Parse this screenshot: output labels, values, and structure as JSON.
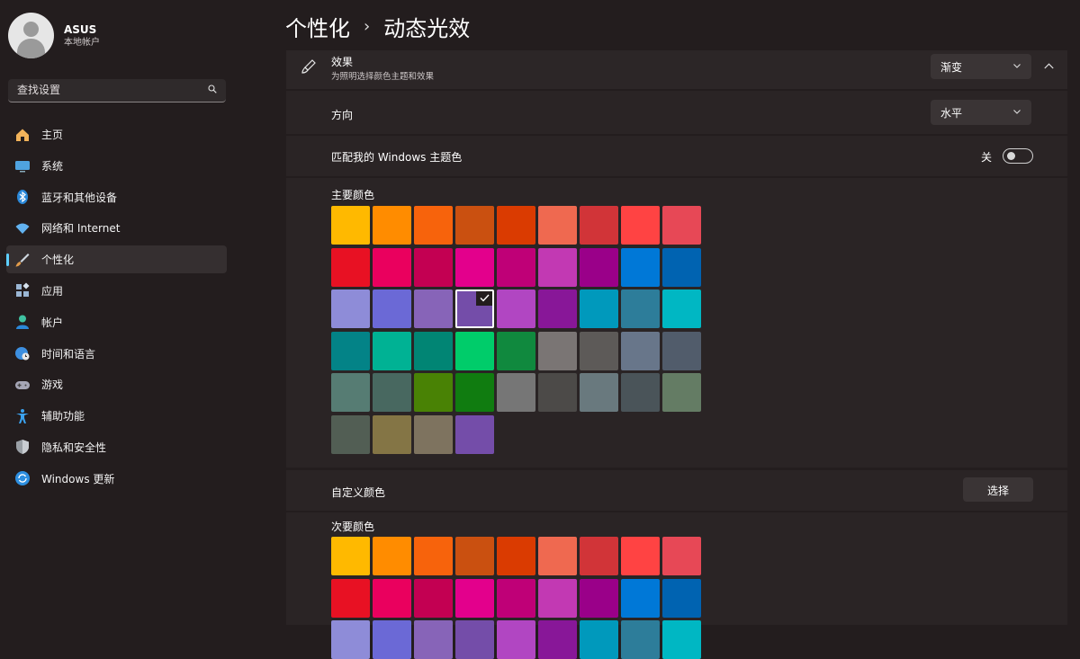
{
  "profile": {
    "name": "ASUS",
    "subtitle": "本地帐户"
  },
  "search": {
    "placeholder": "查找设置",
    "icon": "search-icon"
  },
  "nav": [
    {
      "label": "主页",
      "icon": "home-icon",
      "color": "#f2b35a",
      "active": false
    },
    {
      "label": "系统",
      "icon": "monitor-icon",
      "color": "#4fa3e0",
      "active": false
    },
    {
      "label": "蓝牙和其他设备",
      "icon": "bluetooth-icon",
      "color": "#2b88d8",
      "active": false
    },
    {
      "label": "网络和 Internet",
      "icon": "wifi-icon",
      "color": "#62b2f0",
      "active": false
    },
    {
      "label": "个性化",
      "icon": "brush-icon",
      "color": "#e09a4a",
      "active": true
    },
    {
      "label": "应用",
      "icon": "apps-icon",
      "color": "#9ab6d4",
      "active": false
    },
    {
      "label": "帐户",
      "icon": "account-icon",
      "color": "#3fc2a1",
      "active": false
    },
    {
      "label": "时间和语言",
      "icon": "globe-clock-icon",
      "color": "#3d8fe0",
      "active": false
    },
    {
      "label": "游戏",
      "icon": "gamepad-icon",
      "color": "#a6a6b6",
      "active": false
    },
    {
      "label": "辅助功能",
      "icon": "accessibility-icon",
      "color": "#3ba3f0",
      "active": false
    },
    {
      "label": "隐私和安全性",
      "icon": "shield-icon",
      "color": "#9aa0a6",
      "active": false
    },
    {
      "label": "Windows 更新",
      "icon": "update-icon",
      "color": "#2d8fe0",
      "active": false
    }
  ],
  "breadcrumb": {
    "parent": "个性化",
    "separator": "›",
    "current": "动态光效"
  },
  "effect": {
    "title": "效果",
    "subtitle": "为照明选择颜色主题和效果",
    "value": "渐变"
  },
  "direction": {
    "label": "方向",
    "value": "水平"
  },
  "match_theme": {
    "label": "匹配我的 Windows 主题色",
    "state_label": "关",
    "on": false
  },
  "primary_colors": {
    "label": "主要颜色",
    "selected_index": 21,
    "swatches": [
      "#ffb900",
      "#ff8c00",
      "#f7630c",
      "#ca5010",
      "#da3b01",
      "#ef6950",
      "#d13438",
      "#ff4343",
      "#e74856",
      "#e81123",
      "#ea005e",
      "#c30052",
      "#e3008c",
      "#bf0077",
      "#c239b3",
      "#9a0089",
      "#0078d7",
      "#0063b1",
      "#8e8cd8",
      "#6b69d6",
      "#8764b8",
      "#744da9",
      "#b146c2",
      "#881798",
      "#0099bc",
      "#2d7d9a",
      "#00b7c3",
      "#038387",
      "#00b294",
      "#018574",
      "#00cc6a",
      "#10893e",
      "#7a7574",
      "#5d5a58",
      "#68768a",
      "#515c6b",
      "#567c73",
      "#486860",
      "#498205",
      "#107c10",
      "#767676",
      "#4c4a48",
      "#69797e",
      "#4a5459",
      "#647c64",
      "#525e54",
      "#847545",
      "#7e735f",
      "#744da9"
    ]
  },
  "custom_color": {
    "label": "自定义颜色",
    "button": "选择"
  },
  "secondary_colors": {
    "label": "次要颜色",
    "swatches": [
      "#ffb900",
      "#ff8c00",
      "#f7630c",
      "#ca5010",
      "#da3b01",
      "#ef6950",
      "#d13438",
      "#ff4343",
      "#e74856",
      "#e81123",
      "#ea005e",
      "#c30052",
      "#e3008c",
      "#bf0077",
      "#c239b3",
      "#9a0089",
      "#0078d7",
      "#0063b1",
      "#8e8cd8",
      "#6b69d6",
      "#8764b8",
      "#744da9",
      "#b146c2",
      "#881798",
      "#0099bc",
      "#2d7d9a",
      "#00b7c3"
    ]
  }
}
